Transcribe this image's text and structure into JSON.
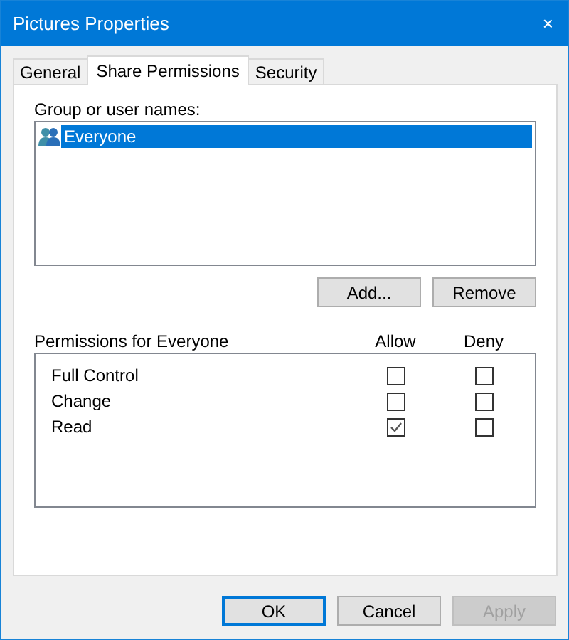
{
  "window": {
    "title": "Pictures Properties",
    "close": "×"
  },
  "tabs": [
    {
      "label": "General",
      "selected": false
    },
    {
      "label": "Share Permissions",
      "selected": true
    },
    {
      "label": "Security",
      "selected": false
    }
  ],
  "group_label": "Group or user names:",
  "users": [
    {
      "name": "Everyone",
      "selected": true
    }
  ],
  "user_buttons": [
    {
      "label": "Add...",
      "disabled": false,
      "default": false
    },
    {
      "label": "Remove",
      "disabled": false,
      "default": false
    }
  ],
  "permissions": {
    "title": "Permissions for Everyone",
    "columns": [
      "Allow",
      "Deny"
    ],
    "rows": [
      {
        "name": "Full Control",
        "allow": false,
        "deny": false
      },
      {
        "name": "Change",
        "allow": false,
        "deny": false
      },
      {
        "name": "Read",
        "allow": true,
        "deny": false
      }
    ]
  },
  "buttons": [
    {
      "label": "OK",
      "disabled": false,
      "default": true
    },
    {
      "label": "Cancel",
      "disabled": false,
      "default": false
    },
    {
      "label": "Apply",
      "disabled": true,
      "default": false
    }
  ]
}
